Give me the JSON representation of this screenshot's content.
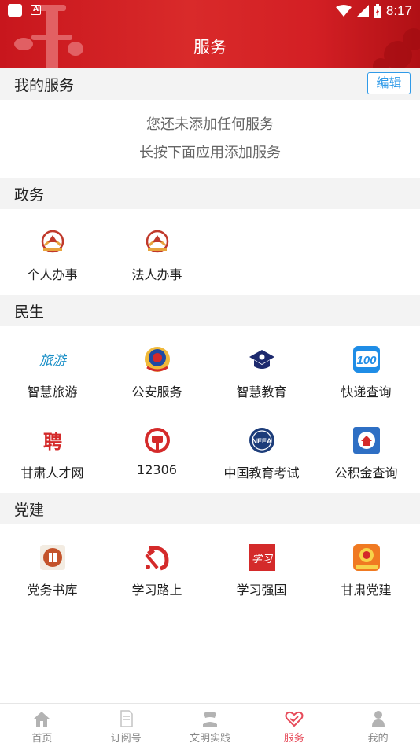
{
  "status_bar": {
    "time": "8:17"
  },
  "header": {
    "title": "服务"
  },
  "my_services": {
    "title": "我的服务",
    "edit_label": "编辑",
    "empty_line1": "您还未添加任何服务",
    "empty_line2": "长按下面应用添加服务"
  },
  "sections": [
    {
      "title": "政务",
      "items": [
        {
          "label": "个人办事",
          "icon": "gov-emblem-icon"
        },
        {
          "label": "法人办事",
          "icon": "gov-emblem-icon"
        }
      ]
    },
    {
      "title": "民生",
      "items": [
        {
          "label": "智慧旅游",
          "icon": "travel-icon"
        },
        {
          "label": "公安服务",
          "icon": "police-badge-icon"
        },
        {
          "label": "智慧教育",
          "icon": "education-cap-icon"
        },
        {
          "label": "快递查询",
          "icon": "express-100-icon"
        },
        {
          "label": "甘肃人才网",
          "icon": "recruit-icon"
        },
        {
          "label": "12306",
          "icon": "railway-icon"
        },
        {
          "label": "中国教育考试",
          "icon": "neea-icon"
        },
        {
          "label": "公积金查询",
          "icon": "housing-fund-icon"
        }
      ]
    },
    {
      "title": "党建",
      "items": [
        {
          "label": "党务书库",
          "icon": "party-library-icon"
        },
        {
          "label": "学习路上",
          "icon": "hammer-sickle-icon"
        },
        {
          "label": "学习强国",
          "icon": "xuexi-icon"
        },
        {
          "label": "甘肃党建",
          "icon": "gansu-party-icon"
        }
      ]
    }
  ],
  "tabbar": [
    {
      "label": "首页",
      "icon": "home-icon"
    },
    {
      "label": "订阅号",
      "icon": "subscribe-icon"
    },
    {
      "label": "文明实践",
      "icon": "practice-icon"
    },
    {
      "label": "服务",
      "icon": "service-heart-icon",
      "active": true
    },
    {
      "label": "我的",
      "icon": "person-icon"
    }
  ],
  "colors": {
    "header_red": "#d31f24",
    "accent_blue": "#2f9ae8",
    "active_tab": "#e74b5a"
  }
}
